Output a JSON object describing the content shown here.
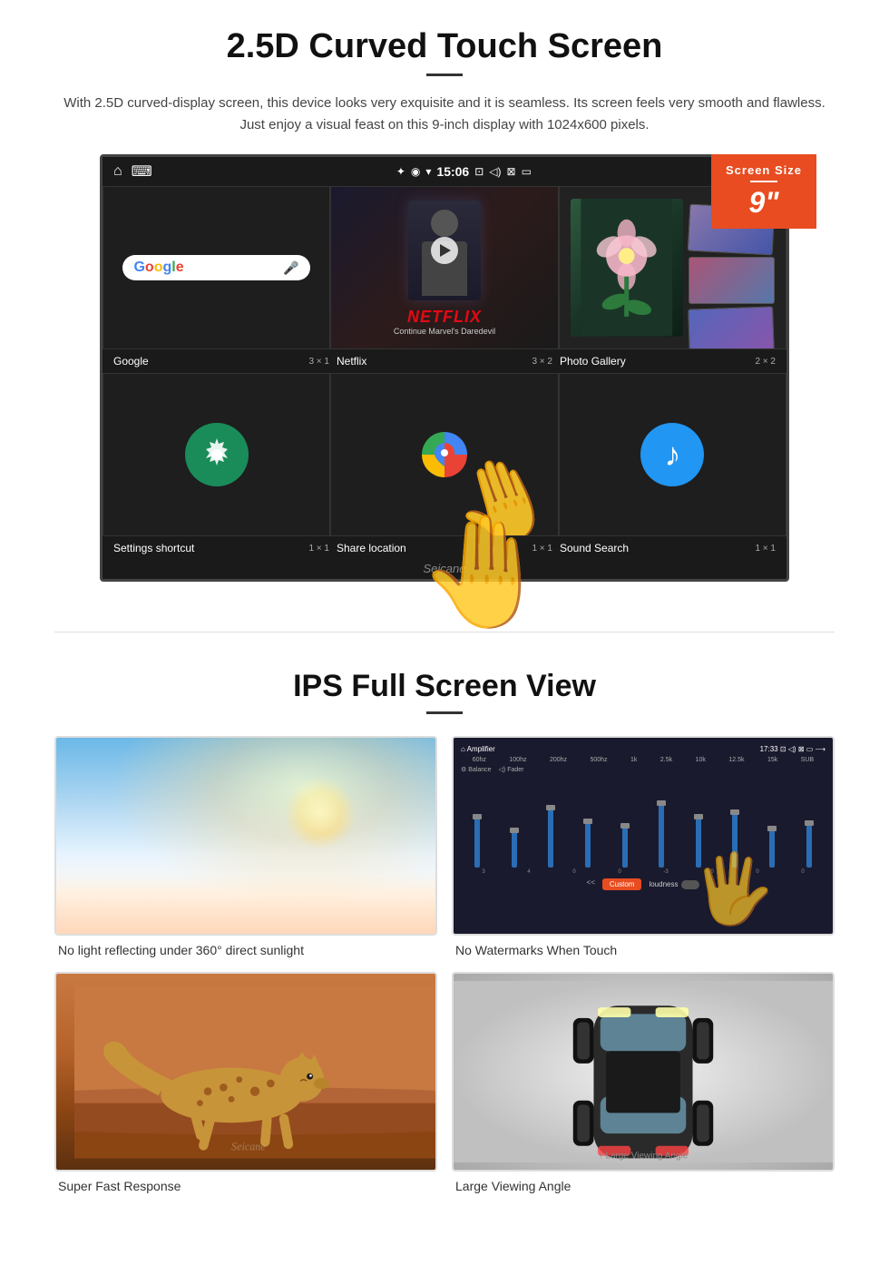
{
  "section1": {
    "title": "2.5D Curved Touch Screen",
    "description": "With 2.5D curved-display screen, this device looks very exquisite and it is seamless. Its screen feels very smooth and flawless. Just enjoy a visual feast on this 9-inch display with 1024x600 pixels.",
    "badge": {
      "label": "Screen Size",
      "size": "9\""
    },
    "statusBar": {
      "time": "15:06"
    },
    "apps": [
      {
        "name": "Google",
        "size": "3 × 1"
      },
      {
        "name": "Netflix",
        "size": "3 × 2"
      },
      {
        "name": "Photo Gallery",
        "size": "2 × 2"
      }
    ],
    "apps2": [
      {
        "name": "Settings shortcut",
        "size": "1 × 1"
      },
      {
        "name": "Share location",
        "size": "1 × 1"
      },
      {
        "name": "Sound Search",
        "size": "1 × 1"
      }
    ],
    "netflix": {
      "logo": "NETFLIX",
      "subtitle": "Continue Marvel's Daredevil"
    },
    "watermark": "Seicane"
  },
  "section2": {
    "title": "IPS Full Screen View",
    "features": [
      {
        "caption": "No light reflecting under 360° direct sunlight"
      },
      {
        "caption": "No Watermarks When Touch"
      },
      {
        "caption": "Super Fast Response"
      },
      {
        "caption": "Large Viewing Angle"
      }
    ]
  }
}
